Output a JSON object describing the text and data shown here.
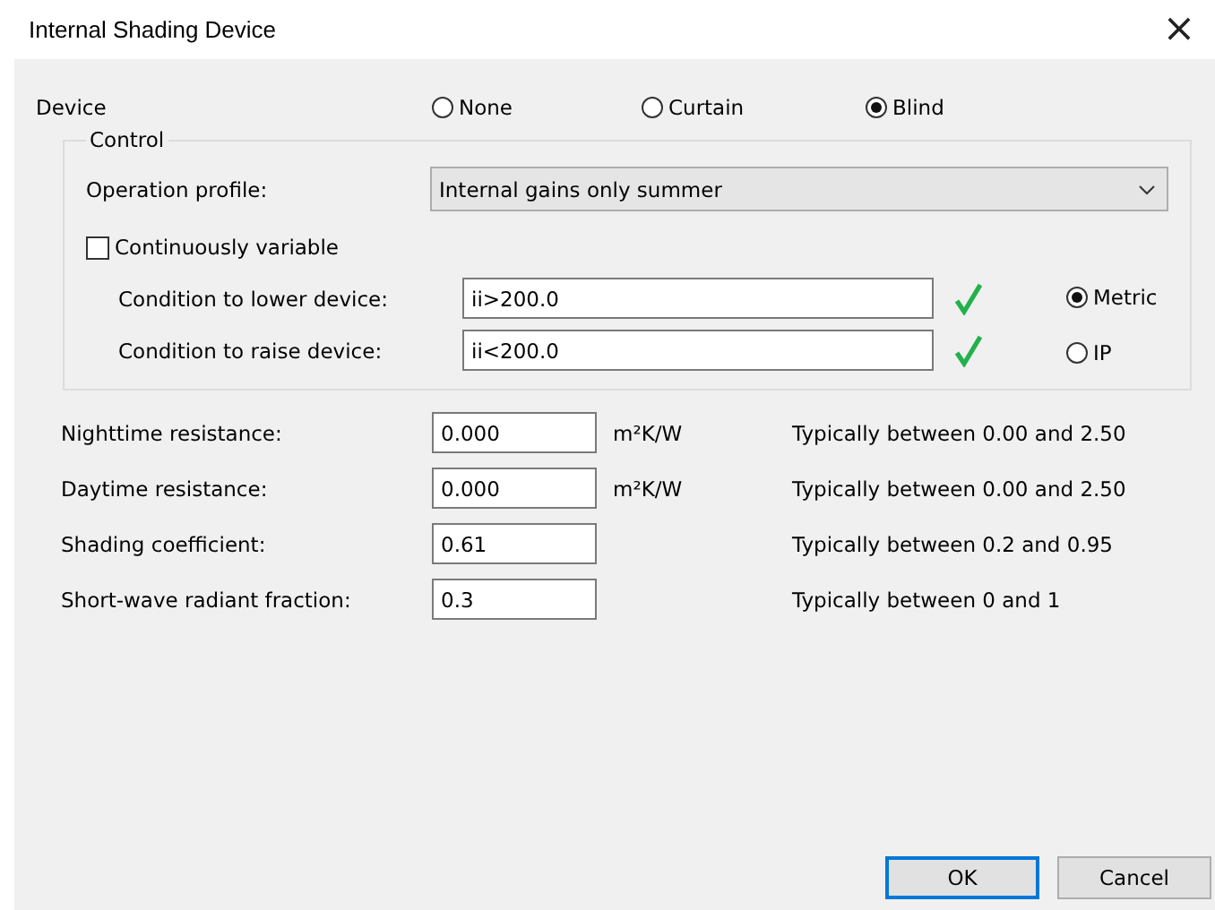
{
  "window": {
    "title": "Internal Shading Device",
    "close": "×"
  },
  "device": {
    "label": "Device",
    "options": [
      {
        "label": "None",
        "selected": false
      },
      {
        "label": "Curtain",
        "selected": false
      },
      {
        "label": "Blind",
        "selected": true
      }
    ]
  },
  "control": {
    "title": "Control",
    "operation_profile": {
      "label": "Operation profile:",
      "value": "Internal gains only summer"
    },
    "continuously_variable": {
      "label": "Continuously variable",
      "checked": false
    },
    "conditions": [
      {
        "label": "Condition to lower device:",
        "value": "ii>200.0",
        "valid": true
      },
      {
        "label": "Condition to raise device:",
        "value": "ii<200.0",
        "valid": true
      }
    ],
    "units": [
      {
        "label": "Metric",
        "selected": true
      },
      {
        "label": "IP",
        "selected": false
      }
    ]
  },
  "properties": [
    {
      "label": "Nighttime resistance:",
      "value": "0.000",
      "unit": "m²K/W",
      "hint": "Typically between 0.00 and 2.50"
    },
    {
      "label": "Daytime resistance:",
      "value": "0.000",
      "unit": "m²K/W",
      "hint": "Typically between 0.00 and 2.50"
    },
    {
      "label": "Shading coefficient:",
      "value": "0.61",
      "hint": "Typically between 0.2 and 0.95"
    },
    {
      "label": "Short-wave radiant fraction:",
      "value": "0.3",
      "hint": "Typically between 0 and 1"
    }
  ],
  "buttons": [
    {
      "label": "OK",
      "default": true
    },
    {
      "label": "Cancel",
      "default": false
    }
  ]
}
